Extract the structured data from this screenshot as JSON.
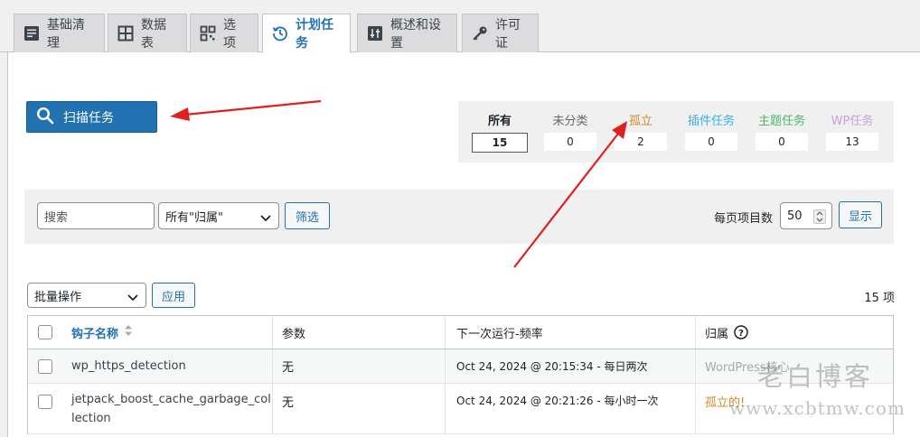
{
  "tabs": [
    {
      "label": "基础清理",
      "icon": "document-icon"
    },
    {
      "label": "数据表",
      "icon": "table-icon"
    },
    {
      "label": "选项",
      "icon": "qr-grid-icon"
    },
    {
      "label": "计划任务",
      "icon": "clock-history-icon",
      "active": true
    },
    {
      "label": "概述和设置",
      "icon": "sliders-icon"
    },
    {
      "label": "许可证",
      "icon": "key-icon"
    }
  ],
  "scan_button": {
    "label": "扫描任务",
    "icon": "search-icon"
  },
  "stats": [
    {
      "label": "所有",
      "value": "15",
      "color": "#1d2327"
    },
    {
      "label": "未分类",
      "value": "0",
      "color": "#646970"
    },
    {
      "label": "孤立",
      "value": "2",
      "color": "#d68a2f"
    },
    {
      "label": "插件任务",
      "value": "0",
      "color": "#3ab0e2"
    },
    {
      "label": "主题任务",
      "value": "0",
      "color": "#4ab866"
    },
    {
      "label": "WP任务",
      "value": "13",
      "color": "#c9a0dc"
    }
  ],
  "filter": {
    "search_placeholder": "搜索",
    "owner_select": "所有\"归属\"",
    "filter_button": "筛选",
    "per_page_label": "每页项目数",
    "per_page_value": "50",
    "show_button": "显示"
  },
  "bulk": {
    "select": "批量操作",
    "apply_button": "应用"
  },
  "item_count": "15 项",
  "table": {
    "headers": {
      "hook": "钩子名称",
      "args": "参数",
      "next_run": "下一次运行-频率",
      "owner": "归属"
    },
    "rows": [
      {
        "hook": "wp_https_detection",
        "args": "无",
        "next_run": "Oct 24, 2024 @ 20:15:34 - 每日两次",
        "owner": "WordPress核心"
      },
      {
        "hook": "jetpack_boost_cache_garbage_collection",
        "args": "无",
        "next_run": "Oct 24, 2024 @ 20:21:26 - 每小时一次",
        "owner": "孤立的!"
      }
    ]
  },
  "watermark": {
    "line1": "老白博客",
    "line2": "www.xcbtmw.com"
  }
}
